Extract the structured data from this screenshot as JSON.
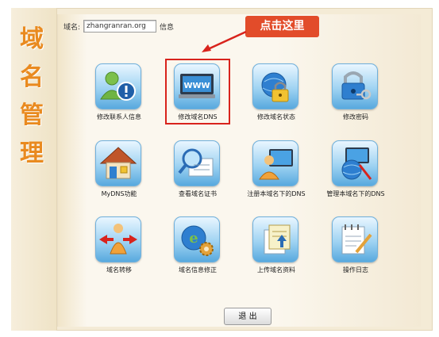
{
  "page_title_chars": [
    "域",
    "名",
    "管",
    "理"
  ],
  "domain_bar": {
    "label": "域名:",
    "value": "zhangranran.org",
    "suffix": "信息"
  },
  "callout": {
    "text": "点击这里",
    "color": "#e24c2a"
  },
  "tiles": [
    {
      "label": "修改联系人信息",
      "icon": "contact-user-info-icon"
    },
    {
      "label": "修改域名DNS",
      "icon": "www-monitor-icon"
    },
    {
      "label": "修改域名状态",
      "icon": "globe-lock-icon"
    },
    {
      "label": "修改密码",
      "icon": "padlock-key-icon"
    },
    {
      "label": "MyDNS功能",
      "icon": "house-icon"
    },
    {
      "label": "查看域名证书",
      "icon": "magnifier-certificate-icon"
    },
    {
      "label": "注册本域名下的DNS",
      "icon": "person-monitor-icon"
    },
    {
      "label": "管理本域名下的DNS",
      "icon": "globe-tools-icon"
    },
    {
      "label": "域名转移",
      "icon": "person-arrows-icon"
    },
    {
      "label": "域名信息修正",
      "icon": "globe-gear-icon"
    },
    {
      "label": "上传域名资料",
      "icon": "document-upload-icon"
    },
    {
      "label": "操作日志",
      "icon": "notepad-pencil-icon"
    }
  ],
  "logout_button": {
    "label": "退 出"
  },
  "colors": {
    "title_accent": "#e98a1f",
    "highlight_border": "#d8231c",
    "icon_blue": "#58a9de"
  }
}
